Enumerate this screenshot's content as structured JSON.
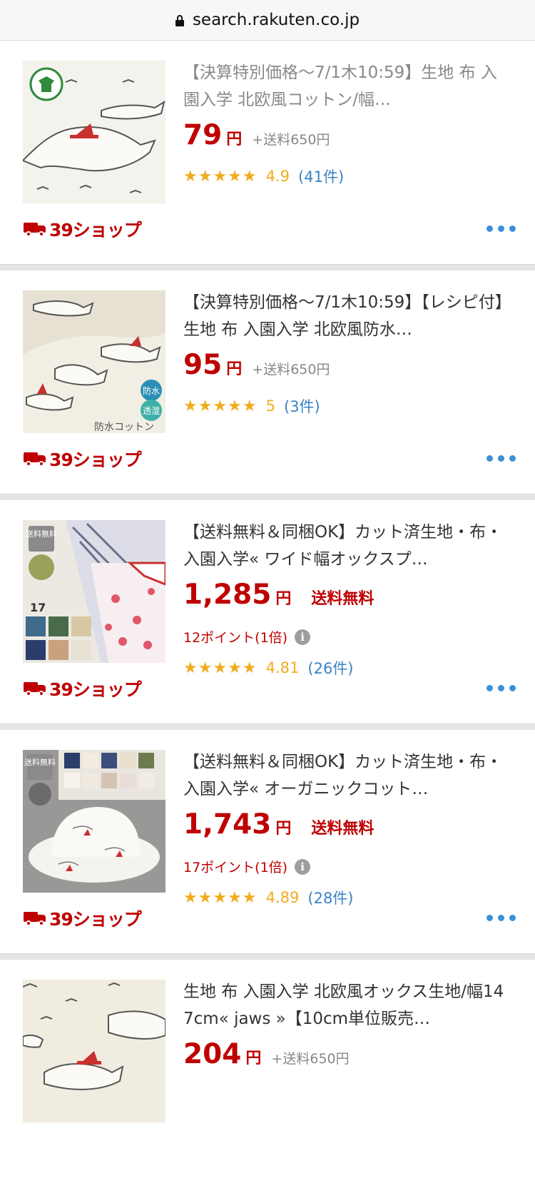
{
  "browser": {
    "url": "search.rakuten.co.jp"
  },
  "products": [
    {
      "title": "【決算特別価格～7/1木10:59】生地 布 入園入学 北欧風コットン/幅…",
      "visited": true,
      "price": "79",
      "yen": "円",
      "shipping": "+送料650円",
      "free_shipping": "",
      "points": "",
      "stars": "★★★★★",
      "score": "4.9",
      "reviews": "(41件)",
      "shop_badge": "39ショップ",
      "image": "shark-fabric-with-organic-logo"
    },
    {
      "title": "【決算特別価格～7/1木10:59】【レシピ付】生地 布 入園入学 北欧風防水…",
      "visited": false,
      "price": "95",
      "yen": "円",
      "shipping": "+送料650円",
      "free_shipping": "",
      "points": "",
      "stars": "★★★★★",
      "score": "5",
      "reviews": "(3件)",
      "shop_badge": "39ショップ",
      "image": "waterproof-shark-fabric",
      "image_text": {
        "badge1": "防水",
        "badge2": "透湿",
        "caption": "防水コットン"
      }
    },
    {
      "title": "【送料無料＆同梱OK】カット済生地・布・入園入学« ワイド幅オックスプ…",
      "visited": false,
      "price": "1,285",
      "yen": "円",
      "shipping": "",
      "free_shipping": "送料無料",
      "points": "12ポイント(1倍)",
      "stars": "★★★★★",
      "score": "4.81",
      "reviews": "(26件)",
      "shop_badge": "39ショップ",
      "image": "cut-fabric-assortment",
      "image_text": {
        "badge": "送料無料",
        "num": "17"
      }
    },
    {
      "title": "【送料無料＆同梱OK】カット済生地・布・入園入学« オーガニックコット…",
      "visited": false,
      "price": "1,743",
      "yen": "円",
      "shipping": "",
      "free_shipping": "送料無料",
      "points": "17ポイント(1倍)",
      "stars": "★★★★★",
      "score": "4.89",
      "reviews": "(28件)",
      "shop_badge": "39ショップ",
      "image": "bucket-hat-shark-fabric",
      "image_text": {
        "badge": "送料無料"
      }
    },
    {
      "title": "生地 布 入園入学 北欧風オックス生地/幅147cm« jaws »【10cm単位販売…",
      "visited": false,
      "price": "204",
      "yen": "円",
      "shipping": "+送料650円",
      "free_shipping": "",
      "points": "",
      "stars": "",
      "score": "",
      "reviews": "",
      "shop_badge": "",
      "image": "jaws-shark-fabric"
    }
  ],
  "icons": {
    "lock": "lock-icon",
    "more": "more-dots-icon",
    "truck": "truck-icon",
    "info": "info-icon"
  },
  "colors": {
    "price_red": "#bf0000",
    "star_gold": "#f0ac1d",
    "link_blue": "#3a82c4",
    "dots_blue": "#3a90d9"
  },
  "info_glyph": "i"
}
